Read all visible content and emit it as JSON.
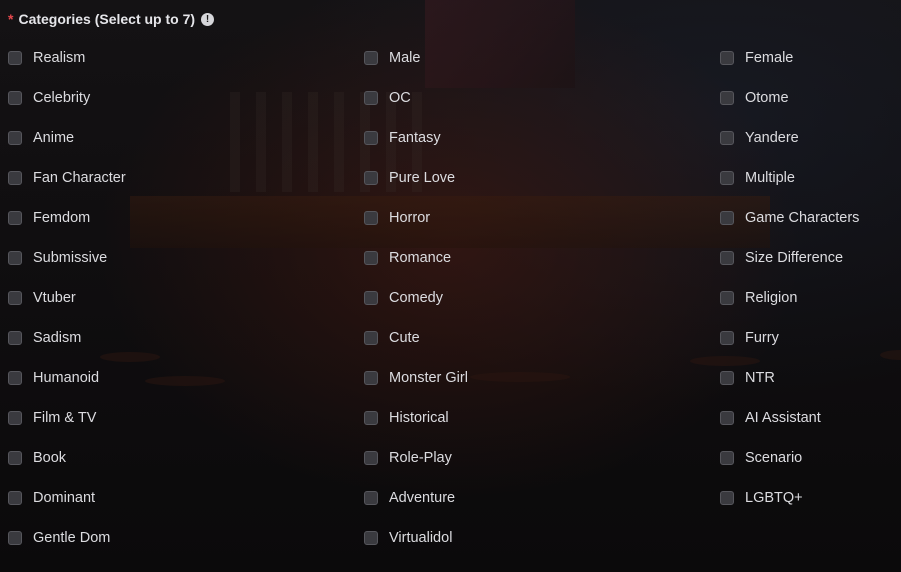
{
  "header": {
    "required_mark": "*",
    "title": "Categories (Select up to 7)",
    "info_icon": "info-icon"
  },
  "colors": {
    "required": "#e5484d",
    "text": "#dcdce0",
    "checkbox_fill": "#3a3a3f",
    "checkbox_border": "#56565c"
  },
  "columns": [
    {
      "options": [
        {
          "label": "Realism",
          "checked": false
        },
        {
          "label": "Celebrity",
          "checked": false
        },
        {
          "label": "Anime",
          "checked": false
        },
        {
          "label": "Fan Character",
          "checked": false
        },
        {
          "label": "Femdom",
          "checked": false
        },
        {
          "label": "Submissive",
          "checked": false
        },
        {
          "label": "Vtuber",
          "checked": false
        },
        {
          "label": "Sadism",
          "checked": false
        },
        {
          "label": "Humanoid",
          "checked": false
        },
        {
          "label": "Film & TV",
          "checked": false
        },
        {
          "label": "Book",
          "checked": false
        },
        {
          "label": "Dominant",
          "checked": false
        },
        {
          "label": "Gentle Dom",
          "checked": false
        }
      ]
    },
    {
      "options": [
        {
          "label": "Male",
          "checked": false
        },
        {
          "label": "OC",
          "checked": false
        },
        {
          "label": "Fantasy",
          "checked": false
        },
        {
          "label": "Pure Love",
          "checked": false
        },
        {
          "label": "Horror",
          "checked": false
        },
        {
          "label": "Romance",
          "checked": false
        },
        {
          "label": "Comedy",
          "checked": false
        },
        {
          "label": "Cute",
          "checked": false
        },
        {
          "label": "Monster Girl",
          "checked": false
        },
        {
          "label": "Historical",
          "checked": false
        },
        {
          "label": "Role-Play",
          "checked": false
        },
        {
          "label": "Adventure",
          "checked": false
        },
        {
          "label": "Virtualidol",
          "checked": false
        }
      ]
    },
    {
      "options": [
        {
          "label": "Female",
          "checked": false
        },
        {
          "label": "Otome",
          "checked": false
        },
        {
          "label": "Yandere",
          "checked": false
        },
        {
          "label": "Multiple",
          "checked": false
        },
        {
          "label": "Game Characters",
          "checked": false
        },
        {
          "label": "Size Difference",
          "checked": false
        },
        {
          "label": "Religion",
          "checked": false
        },
        {
          "label": "Furry",
          "checked": false
        },
        {
          "label": "NTR",
          "checked": false
        },
        {
          "label": "AI Assistant",
          "checked": false
        },
        {
          "label": "Scenario",
          "checked": false
        },
        {
          "label": "LGBTQ+",
          "checked": false
        }
      ]
    }
  ]
}
